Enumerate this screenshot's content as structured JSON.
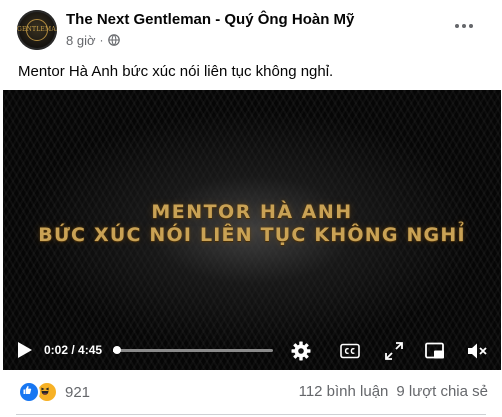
{
  "post": {
    "page_name": "The Next Gentleman - Quý Ông Hoàn Mỹ",
    "time": "8 giờ",
    "separator": "·",
    "caption": "Mentor Hà Anh bức xúc nói liên tục không nghỉ.",
    "avatar_logo_text": "GENTLEMAN"
  },
  "video": {
    "title_line1": "MENTOR HÀ ANH",
    "title_line2": "BỨC XÚC NÓI LIÊN TỤC KHÔNG NGHỈ",
    "time_display": "0:02 / 4:45",
    "progress_fraction": 0.007,
    "icons": [
      "play-icon",
      "settings-icon",
      "captions-icon",
      "expand-icon",
      "picture-in-picture-icon",
      "volume-icon"
    ]
  },
  "footer": {
    "reaction_count": "921",
    "comments": "112 bình luận",
    "shares": "9 lượt chia sẻ",
    "reaction_icons": [
      "like-icon",
      "haha-icon"
    ]
  },
  "colors": {
    "accent_blue": "#1877f2",
    "secondary_text": "#65676b",
    "video_title_gold": "#c9a255"
  }
}
